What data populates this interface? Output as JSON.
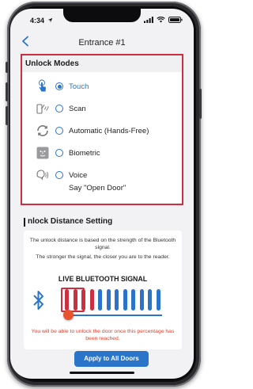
{
  "status_bar": {
    "time": "4:34"
  },
  "nav": {
    "title": "Entrance #1",
    "back_icon": "chevron-left-icon"
  },
  "unlock_modes": {
    "header": "Unlock Modes",
    "selected_index": 0,
    "items": [
      {
        "label": "Touch",
        "icon": "touch-hand-icon",
        "selected": true
      },
      {
        "label": "Scan",
        "icon": "scan-phone-icon",
        "selected": false
      },
      {
        "label": "Automatic (Hands-Free)",
        "icon": "auto-sync-icon",
        "selected": false
      },
      {
        "label": "Biometric",
        "icon": "face-id-icon",
        "selected": false
      },
      {
        "label": "Voice",
        "sublabel": "Say \"Open Door\"",
        "icon": "voice-icon",
        "selected": false
      }
    ]
  },
  "distance": {
    "title": "nlock Distance Setting",
    "description_1": "The unlock distance is based on the strength of the Bluetooth signal.",
    "description_2": "The stronger the signal, the closer you are to the reader.",
    "signal_title": "LIVE BLUETOOTH SIGNAL",
    "signal_bars_total": 12,
    "signal_bars_active": 4,
    "threshold_bars": 3,
    "slider_value": 0.0,
    "warning": "You will be able to unlock the door once this percentage has been reached."
  },
  "apply_button": "Apply to All Doors",
  "colors": {
    "accent": "#2a74c9",
    "highlight": "#cc2f3f",
    "bar_active": "#cc2f3f",
    "bar_inactive": "#2a74c9",
    "knob": "#e8542e",
    "warning": "#e0402e"
  }
}
